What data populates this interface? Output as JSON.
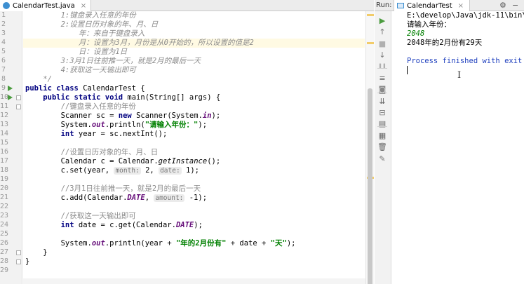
{
  "editor": {
    "tab_label": "CalendarTest.java",
    "line_numbers": [
      "1",
      "2",
      "3",
      "4",
      "5",
      "6",
      "7",
      "8",
      "9",
      "10",
      "11",
      "12",
      "13",
      "14",
      "15",
      "16",
      "17",
      "18",
      "19",
      "20",
      "21",
      "22",
      "23",
      "24",
      "25",
      "26",
      "27",
      "28",
      "29"
    ],
    "lines": [
      {
        "indent": "        ",
        "parts": [
          {
            "c": "cm",
            "t": "1:键盘录入任意的年份"
          }
        ]
      },
      {
        "indent": "        ",
        "parts": [
          {
            "c": "cm",
            "t": "2:设置日历对象的年、月、日"
          }
        ]
      },
      {
        "indent": "            ",
        "parts": [
          {
            "c": "cm",
            "t": "年：来自于键盘录入"
          }
        ]
      },
      {
        "indent": "            ",
        "parts": [
          {
            "c": "cm",
            "t": "月：设置为3月，月份是从0开始的，所以设置的值是2"
          }
        ]
      },
      {
        "indent": "            ",
        "parts": [
          {
            "c": "cm",
            "t": "日：设置为1日"
          }
        ]
      },
      {
        "indent": "        ",
        "parts": [
          {
            "c": "cm",
            "t": "3:3月1日往前推一天，就是2月的最后一天"
          }
        ]
      },
      {
        "indent": "        ",
        "parts": [
          {
            "c": "cm",
            "t": "4:获取这一天输出即可"
          }
        ]
      },
      {
        "indent": "    ",
        "parts": [
          {
            "c": "cm",
            "t": "*/"
          }
        ]
      },
      {
        "indent": "",
        "parts": [
          {
            "c": "kw",
            "t": "public class "
          },
          {
            "c": "",
            "t": "CalendarTest {"
          }
        ]
      },
      {
        "indent": "    ",
        "parts": [
          {
            "c": "kw",
            "t": "public static void "
          },
          {
            "c": "",
            "t": "main(String[] args) {"
          }
        ]
      },
      {
        "indent": "        ",
        "parts": [
          {
            "c": "cmn",
            "t": "//键盘录入任意的年份"
          }
        ]
      },
      {
        "indent": "        ",
        "parts": [
          {
            "c": "",
            "t": "Scanner sc = "
          },
          {
            "c": "kw",
            "t": "new "
          },
          {
            "c": "",
            "t": "Scanner(System."
          },
          {
            "c": "fd",
            "t": "in"
          },
          {
            "c": "",
            "t": ");"
          }
        ]
      },
      {
        "indent": "        ",
        "parts": [
          {
            "c": "",
            "t": "System."
          },
          {
            "c": "fd",
            "t": "out"
          },
          {
            "c": "",
            "t": ".println("
          },
          {
            "c": "st",
            "t": "\"请输入年份：\""
          },
          {
            "c": "",
            "t": ");"
          }
        ]
      },
      {
        "indent": "        ",
        "parts": [
          {
            "c": "kw",
            "t": "int "
          },
          {
            "c": "",
            "t": "year = sc.nextInt();"
          }
        ]
      },
      {
        "indent": "",
        "parts": []
      },
      {
        "indent": "        ",
        "parts": [
          {
            "c": "cmn",
            "t": "//设置日历对象的年、月、日"
          }
        ]
      },
      {
        "indent": "        ",
        "parts": [
          {
            "c": "",
            "t": "Calendar c = Calendar."
          },
          {
            "c": "it",
            "t": "getInstance"
          },
          {
            "c": "",
            "t": "();"
          }
        ]
      },
      {
        "indent": "        ",
        "parts": [
          {
            "c": "",
            "t": "c.set(year, "
          },
          {
            "c": "hint",
            "t": "month:"
          },
          {
            "c": "",
            "t": " 2, "
          },
          {
            "c": "hint",
            "t": "date:"
          },
          {
            "c": "",
            "t": " 1);"
          }
        ]
      },
      {
        "indent": "",
        "parts": []
      },
      {
        "indent": "        ",
        "parts": [
          {
            "c": "cmn",
            "t": "//3月1日往前推一天，就是2月的最后一天"
          }
        ]
      },
      {
        "indent": "        ",
        "parts": [
          {
            "c": "",
            "t": "c.add(Calendar."
          },
          {
            "c": "fd",
            "t": "DATE"
          },
          {
            "c": "",
            "t": ", "
          },
          {
            "c": "hint",
            "t": "amount:"
          },
          {
            "c": "",
            "t": " -1);"
          }
        ]
      },
      {
        "indent": "",
        "parts": []
      },
      {
        "indent": "        ",
        "parts": [
          {
            "c": "cmn",
            "t": "//获取这一天输出即可"
          }
        ]
      },
      {
        "indent": "        ",
        "parts": [
          {
            "c": "kw",
            "t": "int "
          },
          {
            "c": "",
            "t": "date = c.get(Calendar."
          },
          {
            "c": "fd",
            "t": "DATE"
          },
          {
            "c": "",
            "t": ");"
          }
        ]
      },
      {
        "indent": "",
        "parts": []
      },
      {
        "indent": "        ",
        "parts": [
          {
            "c": "",
            "t": "System."
          },
          {
            "c": "fd",
            "t": "out"
          },
          {
            "c": "",
            "t": ".println(year + "
          },
          {
            "c": "st",
            "t": "\"年的2月份有\""
          },
          {
            "c": "",
            "t": " + date + "
          },
          {
            "c": "st",
            "t": "\"天\""
          },
          {
            "c": "",
            "t": ");"
          }
        ]
      },
      {
        "indent": "    ",
        "parts": [
          {
            "c": "",
            "t": "}"
          }
        ]
      },
      {
        "indent": "",
        "parts": [
          {
            "c": "",
            "t": "}"
          }
        ]
      },
      {
        "indent": "",
        "parts": []
      }
    ],
    "run_markers": [
      8,
      9
    ],
    "fold_markers": [
      9,
      10,
      26,
      27
    ]
  },
  "run_panel": {
    "label": "Run:",
    "tab_label": "CalendarTest",
    "toolbar_icons": [
      "rerun-icon",
      "up-arrow-icon",
      "stop-icon",
      "down-arrow-icon",
      "pause-icon",
      "soft-wrap-icon",
      "camera-icon",
      "scroll-to-end-icon",
      "restore-layout-icon",
      "print-icon",
      "layout-icon",
      "trash-icon",
      "pin-icon"
    ],
    "console": [
      {
        "t": "E:\\develop\\Java\\jdk-11\\bin\\",
        "color": "#000000",
        "italic": false
      },
      {
        "t": "请输入年份：",
        "color": "#000000",
        "italic": false
      },
      {
        "t": "2048",
        "color": "#008000",
        "italic": true
      },
      {
        "t": "2048年的2月份有29天",
        "color": "#000000",
        "italic": false
      },
      {
        "t": "",
        "color": "#000000",
        "italic": false
      },
      {
        "t": "Process finished with exit",
        "color": "#1e3fbe",
        "italic": false
      }
    ]
  }
}
